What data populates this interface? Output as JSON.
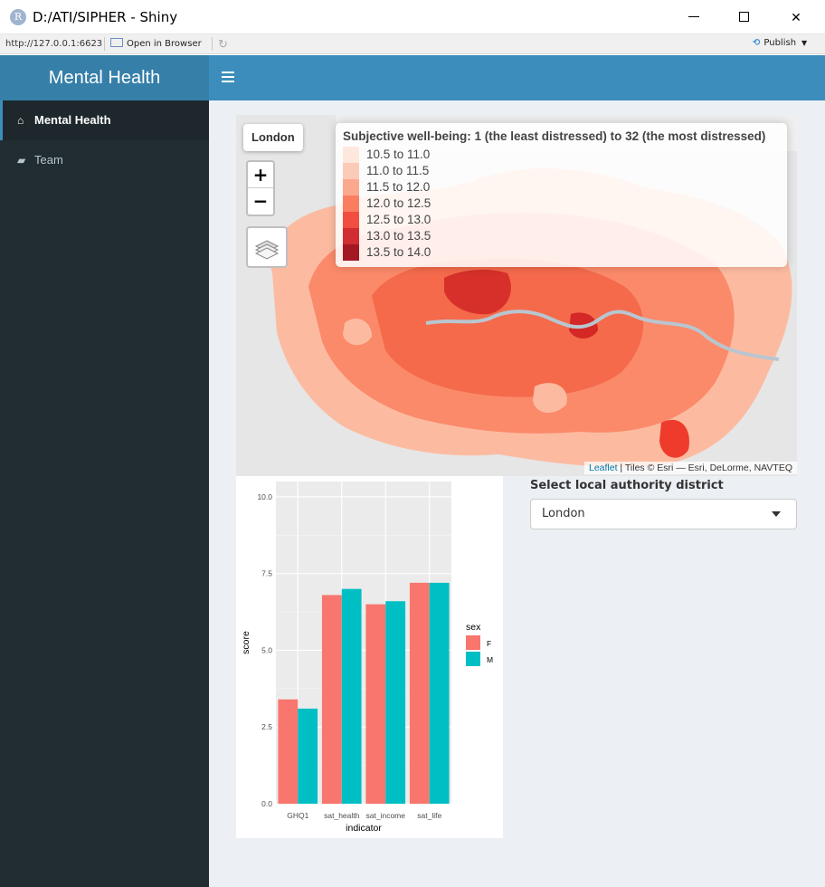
{
  "window": {
    "title": "D:/ATI/SIPHER - Shiny",
    "app_icon": "R",
    "url": "http://127.0.0.1:6623",
    "open_in_browser": "Open in Browser",
    "publish": "Publish"
  },
  "header": {
    "title": "Mental Health"
  },
  "sidebar": {
    "items": [
      {
        "label": "Mental Health",
        "icon": "home-icon",
        "active": true
      },
      {
        "label": "Team",
        "icon": "car-icon",
        "active": false
      }
    ]
  },
  "map": {
    "area_label": "London",
    "zoom_in": "+",
    "zoom_out": "−",
    "legend": {
      "title": "Subjective well-being: 1 (the least distressed) to 32 (the most distressed)",
      "items": [
        {
          "label": "10.5 to 11.0",
          "color": "#fee5d9"
        },
        {
          "label": "11.0 to 11.5",
          "color": "#fcc5b0"
        },
        {
          "label": "11.5 to 12.0",
          "color": "#fc9e80"
        },
        {
          "label": "12.0 to 12.5",
          "color": "#fb7050"
        },
        {
          "label": "12.5 to 13.0",
          "color": "#ef3b2c"
        },
        {
          "label": "13.0 to 13.5",
          "color": "#cb181d"
        },
        {
          "label": "13.5 to 14.0",
          "color": "#99000d"
        }
      ]
    },
    "attribution_link": "Leaflet",
    "attribution_text": " | Tiles © Esri — Esri, DeLorme, NAVTEQ"
  },
  "select": {
    "label": "Select local authority district",
    "value": "London"
  },
  "chart_data": {
    "type": "bar",
    "categories": [
      "GHQ1",
      "sat_health",
      "sat_income",
      "sat_life"
    ],
    "series": [
      {
        "name": "F",
        "color": "#F8766D",
        "values": [
          3.4,
          6.8,
          6.5,
          7.2
        ]
      },
      {
        "name": "M",
        "color": "#00BFC4",
        "values": [
          3.1,
          7.0,
          6.6,
          7.2
        ]
      }
    ],
    "xlabel": "indicator",
    "ylabel": "score",
    "ylim": [
      0,
      10.5
    ],
    "yticks": [
      "0.0",
      "2.5",
      "5.0",
      "7.5",
      "10.0"
    ],
    "legend_title": "sex",
    "legend_position": "right",
    "grid": true
  }
}
